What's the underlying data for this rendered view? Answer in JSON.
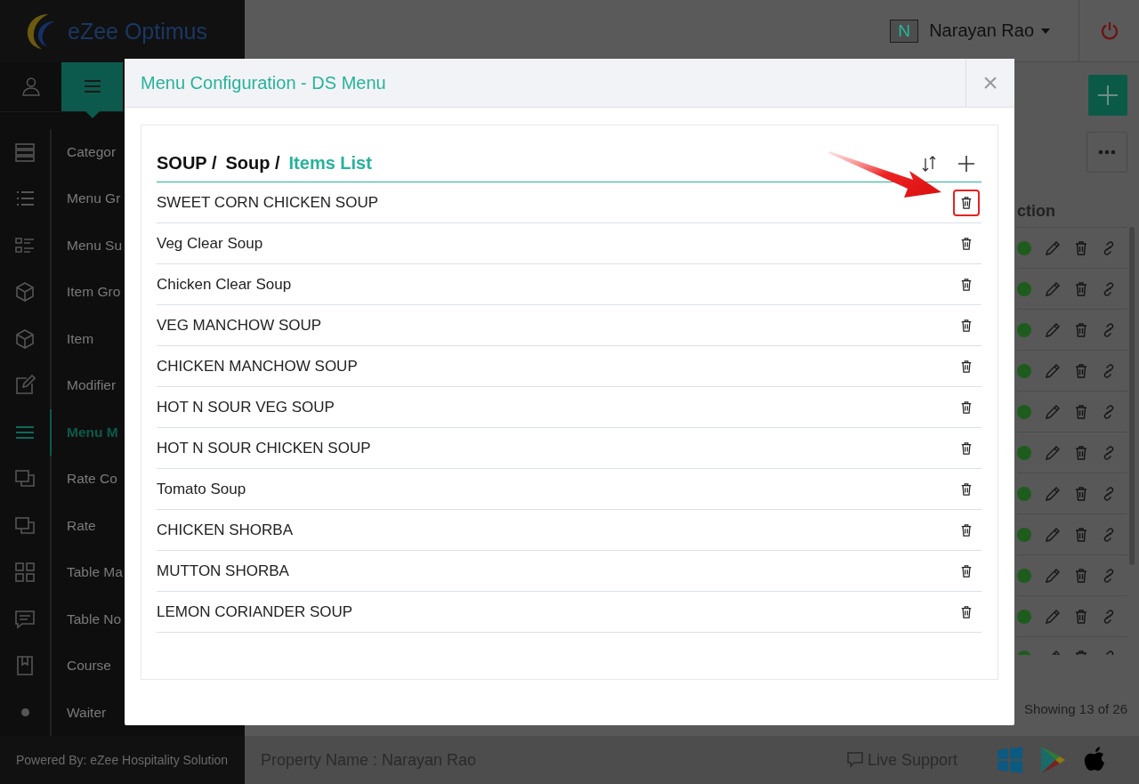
{
  "app": {
    "logo_text": "eZee Optimus",
    "user_initial": "N",
    "user_name": "Narayan Rao"
  },
  "sidebar": {
    "items": [
      {
        "label": "Categor",
        "selected": false
      },
      {
        "label": "Menu Gr",
        "selected": false
      },
      {
        "label": "Menu Su",
        "selected": false
      },
      {
        "label": "Item Gro",
        "selected": false
      },
      {
        "label": "Item",
        "selected": false
      },
      {
        "label": "Modifier",
        "selected": false
      },
      {
        "label": "Menu M",
        "selected": true
      },
      {
        "label": "Rate Co",
        "selected": false
      },
      {
        "label": "Rate",
        "selected": false
      },
      {
        "label": "Table Ma",
        "selected": false
      },
      {
        "label": "Table No",
        "selected": false
      },
      {
        "label": "Course",
        "selected": false
      },
      {
        "label": "Waiter",
        "selected": false
      }
    ]
  },
  "background_table": {
    "column_header": "ction",
    "rows": [
      {
        "active": true
      },
      {
        "active": true
      },
      {
        "active": true
      },
      {
        "active": true
      },
      {
        "active": true
      },
      {
        "active": true
      },
      {
        "active": true
      },
      {
        "active": true
      },
      {
        "active": true
      },
      {
        "active": true
      },
      {
        "active": true
      }
    ],
    "footer_text": "Showing 13 of 26"
  },
  "footer": {
    "powered_by": "Powered By: eZee Hospitality Solution",
    "property": "Property Name : Narayan Rao",
    "support": "Live Support"
  },
  "modal": {
    "title": "Menu Configuration - DS Menu",
    "close": "×",
    "breadcrumb": [
      {
        "label": "SOUP /",
        "current": false
      },
      {
        "label": "Soup /",
        "current": false
      },
      {
        "label": "Items List",
        "current": true
      }
    ],
    "items": [
      {
        "name": "SWEET CORN CHICKEN SOUP",
        "highlighted": true
      },
      {
        "name": "Veg Clear Soup",
        "highlighted": false
      },
      {
        "name": "Chicken Clear Soup",
        "highlighted": false
      },
      {
        "name": "VEG MANCHOW SOUP",
        "highlighted": false
      },
      {
        "name": "CHICKEN MANCHOW SOUP",
        "highlighted": false
      },
      {
        "name": "HOT N SOUR VEG SOUP",
        "highlighted": false
      },
      {
        "name": "HOT N SOUR CHICKEN SOUP",
        "highlighted": false
      },
      {
        "name": "Tomato Soup",
        "highlighted": false
      },
      {
        "name": "CHICKEN SHORBA",
        "highlighted": false
      },
      {
        "name": "MUTTON SHORBA",
        "highlighted": false
      },
      {
        "name": "LEMON CORIANDER SOUP",
        "highlighted": false
      }
    ]
  }
}
